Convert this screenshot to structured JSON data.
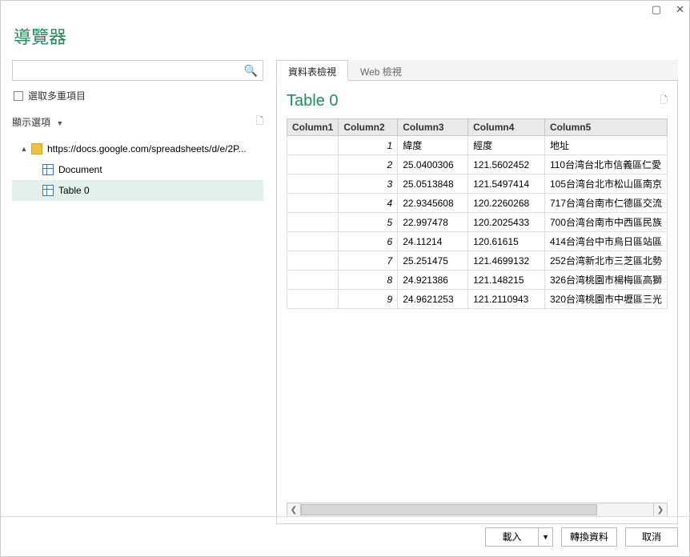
{
  "window": {
    "title": "導覽器"
  },
  "left_panel": {
    "search_placeholder": "",
    "multi_select_label": "選取多重項目",
    "display_options_label": "顯示選項",
    "tree": {
      "root_label": "https://docs.google.com/spreadsheets/d/e/2P...",
      "doc_label": "Document",
      "table_label": "Table 0"
    }
  },
  "preview": {
    "tabs": {
      "table_view": "資料表檢視",
      "web_view": "Web 檢視"
    },
    "title": "Table 0",
    "columns": [
      "Column1",
      "Column2",
      "Column3",
      "Column4",
      "Column5"
    ],
    "rows": [
      {
        "c1": "",
        "c2": "1",
        "c3": "緯度",
        "c4": "經度",
        "c5": "地址"
      },
      {
        "c1": "",
        "c2": "2",
        "c3": "25.0400306",
        "c4": "121.5602452",
        "c5": "110台湾台北市信義區仁愛"
      },
      {
        "c1": "",
        "c2": "3",
        "c3": "25.0513848",
        "c4": "121.5497414",
        "c5": "105台湾台北市松山區南京"
      },
      {
        "c1": "",
        "c2": "4",
        "c3": "22.9345608",
        "c4": "120.2260268",
        "c5": "717台湾台南市仁德區交流"
      },
      {
        "c1": "",
        "c2": "5",
        "c3": "22.997478",
        "c4": "120.2025433",
        "c5": "700台湾台南市中西區民族"
      },
      {
        "c1": "",
        "c2": "6",
        "c3": "24.11214",
        "c4": "120.61615",
        "c5": "414台湾台中市烏日區站區"
      },
      {
        "c1": "",
        "c2": "7",
        "c3": "25.251475",
        "c4": "121.4699132",
        "c5": "252台湾新北市三芝區北勢"
      },
      {
        "c1": "",
        "c2": "8",
        "c3": "24.921386",
        "c4": "121.148215",
        "c5": "326台湾桃園市楊梅區高獅"
      },
      {
        "c1": "",
        "c2": "9",
        "c3": "24.9621253",
        "c4": "121.2110943",
        "c5": "320台湾桃園市中壢區三光"
      }
    ]
  },
  "footer": {
    "load": "載入",
    "transform": "轉換資料",
    "cancel": "取消"
  }
}
